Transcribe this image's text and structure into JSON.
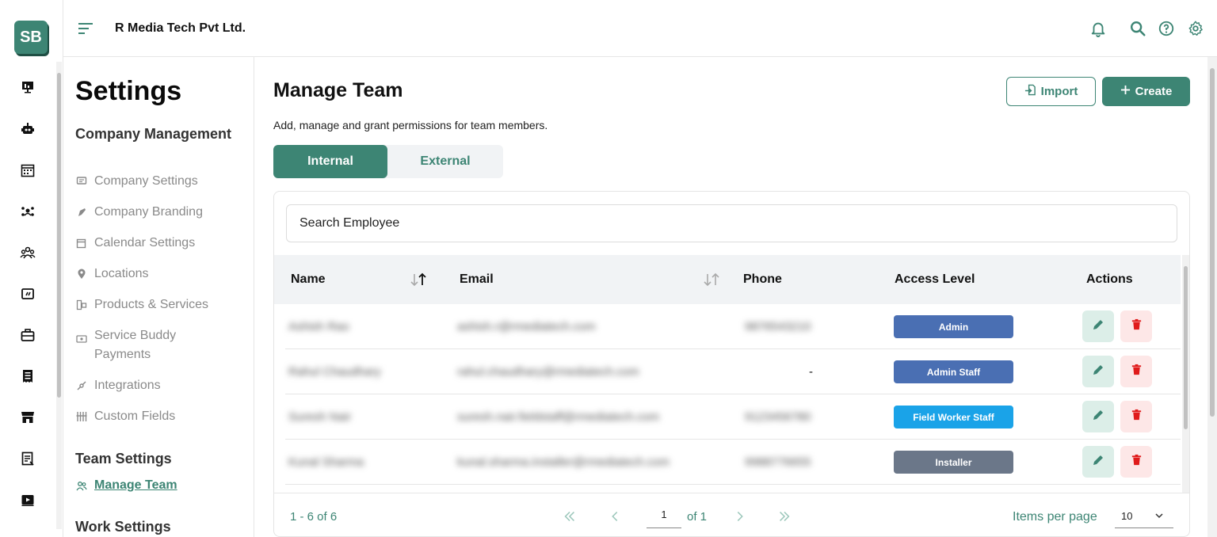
{
  "brand": {
    "logo_text": "SB",
    "accent": "#3d8574"
  },
  "header": {
    "company_name": "R Media Tech Pvt Ltd."
  },
  "rail_icons": [
    "dashboard-icon",
    "robot-icon",
    "calendar-icon",
    "crew-icon",
    "team-icon",
    "board-icon",
    "briefcase-icon",
    "receipt-icon",
    "store-icon",
    "document-icon",
    "media-icon"
  ],
  "settings": {
    "title": "Settings",
    "company_management": {
      "heading": "Company Management",
      "items": [
        {
          "label": "Company Settings",
          "icon": "chat-icon"
        },
        {
          "label": "Company Branding",
          "icon": "brush-icon"
        },
        {
          "label": "Calendar Settings",
          "icon": "calendar-edit-icon"
        },
        {
          "label": "Locations",
          "icon": "pin-icon"
        },
        {
          "label": "Products & Services",
          "icon": "products-icon"
        },
        {
          "label": "Service Buddy Payments",
          "icon": "payment-icon"
        },
        {
          "label": "Integrations",
          "icon": "plug-icon"
        },
        {
          "label": "Custom Fields",
          "icon": "fields-icon"
        }
      ]
    },
    "team_settings": {
      "heading": "Team Settings",
      "items": [
        {
          "label": "Manage Team",
          "icon": "users-icon"
        }
      ]
    },
    "work_settings": {
      "heading": "Work Settings"
    }
  },
  "main": {
    "title": "Manage Team",
    "description": "Add, manage and grant permissions for team members.",
    "import_label": "Import",
    "create_label": "Create",
    "tabs": [
      {
        "label": "Internal"
      },
      {
        "label": "External"
      }
    ],
    "search_placeholder": "Search Employee",
    "columns": {
      "name": "Name",
      "email": "Email",
      "phone": "Phone",
      "access": "Access Level",
      "actions": "Actions"
    },
    "rows": [
      {
        "name": "Ashish Rao",
        "email": "ashish.r@rmediatech.com",
        "phone": "9876543210",
        "access": "Admin",
        "access_color": "#4a6fb3"
      },
      {
        "name": "Rahul Chaudhary",
        "email": "rahul.chaudhary@rmediatech.com",
        "phone": "-",
        "access": "Admin Staff",
        "access_color": "#4a6fb3"
      },
      {
        "name": "Suresh Nair",
        "email": "suresh.nair.fieldstaff@rmediatech.com",
        "phone": "9123456780",
        "access": "Field Worker Staff",
        "access_color": "#1aa3e8"
      },
      {
        "name": "Kunal Sharma",
        "email": "kunal.sharma.installer@rmediatech.com",
        "phone": "9988776655",
        "access": "Installer",
        "access_color": "#6b7789"
      }
    ],
    "pager": {
      "range": "1 - 6 of 6",
      "current_page": "1",
      "of_label": "of 1",
      "items_per_page_label": "Items per page",
      "items_per_page": "10"
    }
  }
}
